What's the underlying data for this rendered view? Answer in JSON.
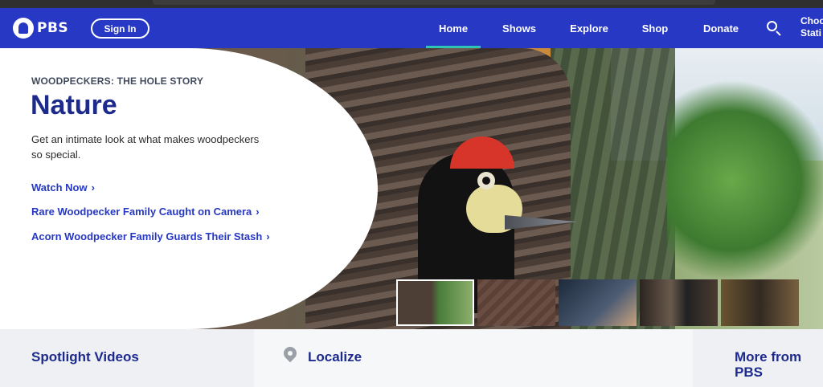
{
  "header": {
    "logo_text": "PBS",
    "signin_label": "Sign In",
    "nav": [
      {
        "label": "Home",
        "active": true
      },
      {
        "label": "Shows",
        "active": false
      },
      {
        "label": "Explore",
        "active": false
      },
      {
        "label": "Shop",
        "active": false
      },
      {
        "label": "Donate",
        "active": false
      }
    ],
    "search_icon": "search-icon",
    "station_label_1": "Choo",
    "station_label_2": "Stati",
    "colors": {
      "brand": "#2638c4",
      "active_underline": "#2ec4b6"
    }
  },
  "hero": {
    "kicker": "WOODPECKERS: THE HOLE STORY",
    "title": "Nature",
    "description": "Get an intimate look at what makes woodpeckers so special.",
    "links": [
      {
        "label": "Watch Now"
      },
      {
        "label": "Rare Woodpecker Family Caught on Camera"
      },
      {
        "label": "Acorn Woodpecker Family Guards Their Stash"
      }
    ],
    "chevron_icon": "chevron-right-icon",
    "thumbnails_count": 5,
    "active_thumbnail": 1
  },
  "sections": [
    {
      "label": "Spotlight Videos"
    },
    {
      "label": "Localize",
      "icon": "location-pin-icon"
    },
    {
      "label": "More from PBS"
    }
  ]
}
